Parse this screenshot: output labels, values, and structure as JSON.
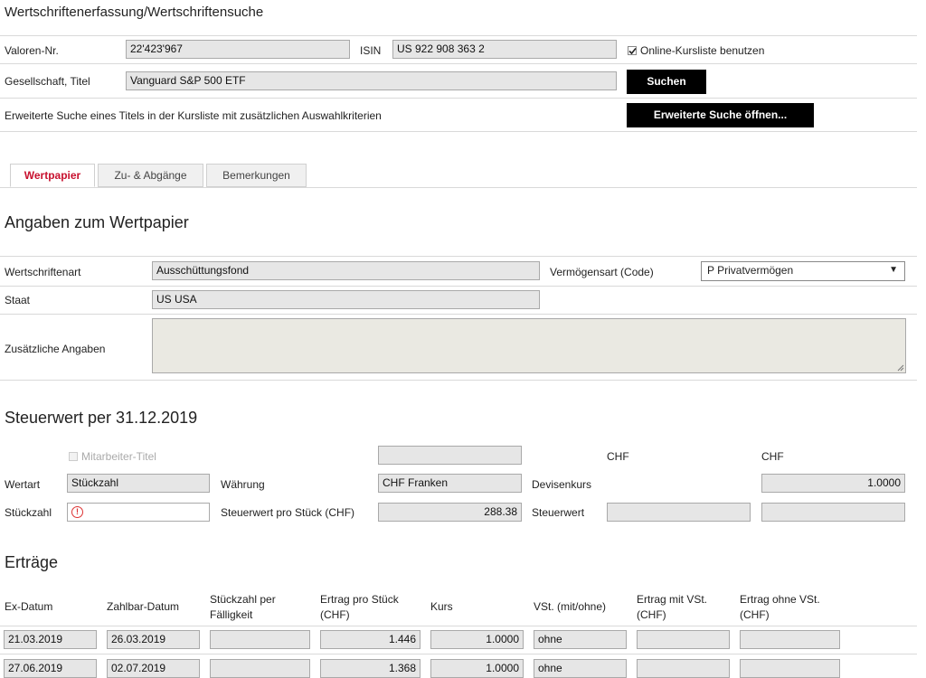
{
  "page": {
    "title": "Wertschriftenerfassung/Wertschriftensuche"
  },
  "search": {
    "valoren_label": "Valoren-Nr.",
    "valoren_value": "22'423'967",
    "isin_label": "ISIN",
    "isin_value": "US 922 908 363 2",
    "online_label": "Online-Kursliste benutzen",
    "gesellschaft_label": "Gesellschaft, Titel",
    "gesellschaft_value": "Vanguard S&P 500 ETF",
    "search_button": "Suchen",
    "extended_label": "Erweiterte Suche eines Titels in der Kursliste mit zusätzlichen Auswahlkriterien",
    "extended_button": "Erweiterte Suche öffnen..."
  },
  "tabs": [
    {
      "label": "Wertpapier"
    },
    {
      "label": "Zu- & Abgänge"
    },
    {
      "label": "Bemerkungen"
    }
  ],
  "angaben": {
    "heading": "Angaben zum Wertpapier",
    "art_label": "Wertschriftenart",
    "art_value": "Ausschüttungsfond",
    "vermoegen_label": "Vermögensart (Code)",
    "vermoegen_value": "P Privatvermögen",
    "staat_label": "Staat",
    "staat_value": "US USA",
    "zusatz_label": "Zusätzliche Angaben"
  },
  "steuerwert": {
    "heading": "Steuerwert per 31.12.2019",
    "mitarbeiter_label": "Mitarbeiter-Titel",
    "chf1": "CHF",
    "chf2": "CHF",
    "wertart_label": "Wertart",
    "wertart_value": "Stückzahl",
    "waehrung_label": "Währung",
    "waehrung_value": "CHF Franken",
    "devisenkurs_label": "Devisenkurs",
    "devisenkurs_value": "1.0000",
    "stueckzahl_label": "Stückzahl",
    "steuerwert_stk_label": "Steuerwert pro Stück (CHF)",
    "steuerwert_stk_value": "288.38",
    "steuerwert_label": "Steuerwert"
  },
  "ertraege": {
    "heading": "Erträge",
    "headers": {
      "ex": "Ex-Datum",
      "zahlbar": "Zahlbar-Datum",
      "stk1": "Stückzahl per",
      "stk2": "Fälligkeit",
      "ertrag1": "Ertrag pro Stück",
      "ertrag2": "(CHF)",
      "kurs": "Kurs",
      "vst": "VSt. (mit/ohne)",
      "mit1": "Ertrag mit VSt.",
      "mit2": "(CHF)",
      "ohne1": "Ertrag ohne VSt.",
      "ohne2": "(CHF)"
    },
    "rows": [
      {
        "ex": "21.03.2019",
        "zahlbar": "26.03.2019",
        "stk": "",
        "ertrag": "1.446",
        "kurs": "1.0000",
        "vst": "ohne",
        "mit": "",
        "ohne": ""
      },
      {
        "ex": "27.06.2019",
        "zahlbar": "02.07.2019",
        "stk": "",
        "ertrag": "1.368",
        "kurs": "1.0000",
        "vst": "ohne",
        "mit": "",
        "ohne": ""
      }
    ]
  }
}
